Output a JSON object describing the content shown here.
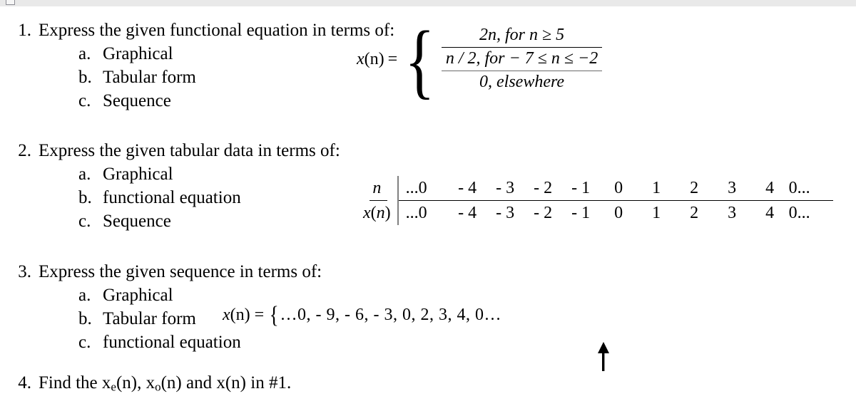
{
  "document": {
    "questions": [
      {
        "number": "1.",
        "text": "Express the given functional equation in terms of:",
        "items": [
          {
            "letter": "a.",
            "label": "Graphical"
          },
          {
            "letter": "b.",
            "label": "Tabular form"
          },
          {
            "letter": "c.",
            "label": "Sequence"
          }
        ]
      },
      {
        "number": "2.",
        "text": "Express the given tabular data in terms of:",
        "items": [
          {
            "letter": "a.",
            "label": "Graphical"
          },
          {
            "letter": "b.",
            "label": "functional equation"
          },
          {
            "letter": "c.",
            "label": "Sequence"
          }
        ]
      },
      {
        "number": "3.",
        "text": "Express the given sequence in terms of:",
        "items": [
          {
            "letter": "a.",
            "label": "Graphical"
          },
          {
            "letter": "b.",
            "label": "Tabular form"
          },
          {
            "letter": "c.",
            "label": "functional equation"
          }
        ]
      },
      {
        "number": "4.",
        "text": "Find the xe(n), xo(n) and x(n) in #1.",
        "text_parts": {
          "lead": "Find the ",
          "var1_base": "x",
          "var1_sub": "e",
          "var1_tail": "(n), ",
          "var2_base": "x",
          "var2_sub": "o",
          "var2_tail": "(n) and x(n) in #1."
        },
        "items": []
      }
    ]
  },
  "piecewise_equation": {
    "lhs_var": "x",
    "lhs_arg": "(n)",
    "equals": "=",
    "open_brace": "{",
    "cases": [
      {
        "expr": "2n, for  n ≥ 5",
        "rule": "black"
      },
      {
        "expr": "n / 2,  for  − 7 ≤ n ≤ −2",
        "rule": "gray"
      },
      {
        "expr": "0, elsewhere",
        "rule": "none"
      }
    ]
  },
  "data_table": {
    "row_labels": [
      "n",
      "x(n)"
    ],
    "rows": [
      {
        "label": "n",
        "values": [
          "...0",
          "- 4",
          "- 3",
          "- 2",
          "- 1",
          "0",
          "1",
          "2",
          "3",
          "4",
          "0..."
        ]
      },
      {
        "label": "x(n)",
        "values": [
          "...0",
          "- 4",
          "- 3",
          "- 2",
          "- 1",
          "0",
          "1",
          "2",
          "3",
          "4",
          "0..."
        ]
      }
    ]
  },
  "sequence_equation": {
    "lhs_var": "x",
    "lhs_arg": "(n)",
    "equals": "=",
    "open_brace": "{",
    "items": "…0,  - 9,  - 6,  - 3,   0,   2,   3,   4,   0…",
    "origin_marker": "up-arrow",
    "origin_value": "0"
  },
  "colors": {
    "text": "#000000",
    "rule_gray": "#6b6b6b",
    "divider_gray": "#808080",
    "spellcheck": "#ff0000",
    "ruler_bg": "#e9e9e9"
  }
}
